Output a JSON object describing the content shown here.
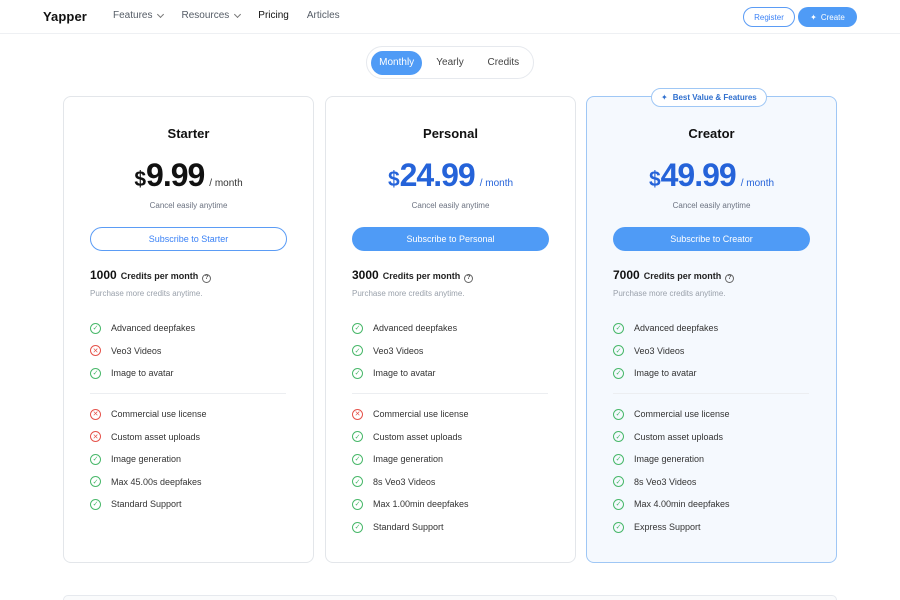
{
  "header": {
    "logo": "Yapper",
    "nav": [
      {
        "label": "Features",
        "dropdown": true,
        "active": false
      },
      {
        "label": "Resources",
        "dropdown": true,
        "active": false
      },
      {
        "label": "Pricing",
        "dropdown": false,
        "active": true
      },
      {
        "label": "Articles",
        "dropdown": false,
        "active": false
      }
    ],
    "register_label": "Register",
    "create_label": "Create"
  },
  "billing_toggle": {
    "options": [
      "Monthly",
      "Yearly",
      "Credits"
    ],
    "selected": "Monthly"
  },
  "plans": [
    {
      "name": "Starter",
      "currency": "$",
      "price": "9.99",
      "period": "/ month",
      "cancel_text": "Cancel easily anytime",
      "button_label": "Subscribe to Starter",
      "credits": "1000",
      "credits_label": "Credits per month",
      "purchase_text": "Purchase more credits anytime.",
      "features_top": [
        {
          "label": "Advanced deepfakes",
          "included": true
        },
        {
          "label": "Veo3 Videos",
          "included": false
        },
        {
          "label": "Image to avatar",
          "included": true
        }
      ],
      "features_bottom": [
        {
          "label": "Commercial use license",
          "included": false
        },
        {
          "label": "Custom asset uploads",
          "included": false
        },
        {
          "label": "Image generation",
          "included": true
        },
        {
          "label": "Max 45.00s deepfakes",
          "included": true
        },
        {
          "label": "Standard Support",
          "included": true
        }
      ]
    },
    {
      "name": "Personal",
      "currency": "$",
      "price": "24.99",
      "period": "/ month",
      "cancel_text": "Cancel easily anytime",
      "button_label": "Subscribe to Personal",
      "credits": "3000",
      "credits_label": "Credits per month",
      "purchase_text": "Purchase more credits anytime.",
      "features_top": [
        {
          "label": "Advanced deepfakes",
          "included": true
        },
        {
          "label": "Veo3 Videos",
          "included": true
        },
        {
          "label": "Image to avatar",
          "included": true
        }
      ],
      "features_bottom": [
        {
          "label": "Commercial use license",
          "included": false
        },
        {
          "label": "Custom asset uploads",
          "included": true
        },
        {
          "label": "Image generation",
          "included": true
        },
        {
          "label": "8s Veo3 Videos",
          "included": true
        },
        {
          "label": "Max 1.00min deepfakes",
          "included": true
        },
        {
          "label": "Standard Support",
          "included": true
        }
      ]
    },
    {
      "name": "Creator",
      "badge": "Best Value & Features",
      "currency": "$",
      "price": "49.99",
      "period": "/ month",
      "cancel_text": "Cancel easily anytime",
      "button_label": "Subscribe to Creator",
      "credits": "7000",
      "credits_label": "Credits per month",
      "purchase_text": "Purchase more credits anytime.",
      "features_top": [
        {
          "label": "Advanced deepfakes",
          "included": true
        },
        {
          "label": "Veo3 Videos",
          "included": true
        },
        {
          "label": "Image to avatar",
          "included": true
        }
      ],
      "features_bottom": [
        {
          "label": "Commercial use license",
          "included": true
        },
        {
          "label": "Custom asset uploads",
          "included": true
        },
        {
          "label": "Image generation",
          "included": true
        },
        {
          "label": "8s Veo3 Videos",
          "included": true
        },
        {
          "label": "Max 4.00min deepfakes",
          "included": true
        },
        {
          "label": "Express Support",
          "included": true
        }
      ]
    }
  ],
  "colors": {
    "accent": "#4f9bf6",
    "price_blue": "#2563d9",
    "check_green": "#49b86a",
    "cross_red": "#e5534b"
  }
}
